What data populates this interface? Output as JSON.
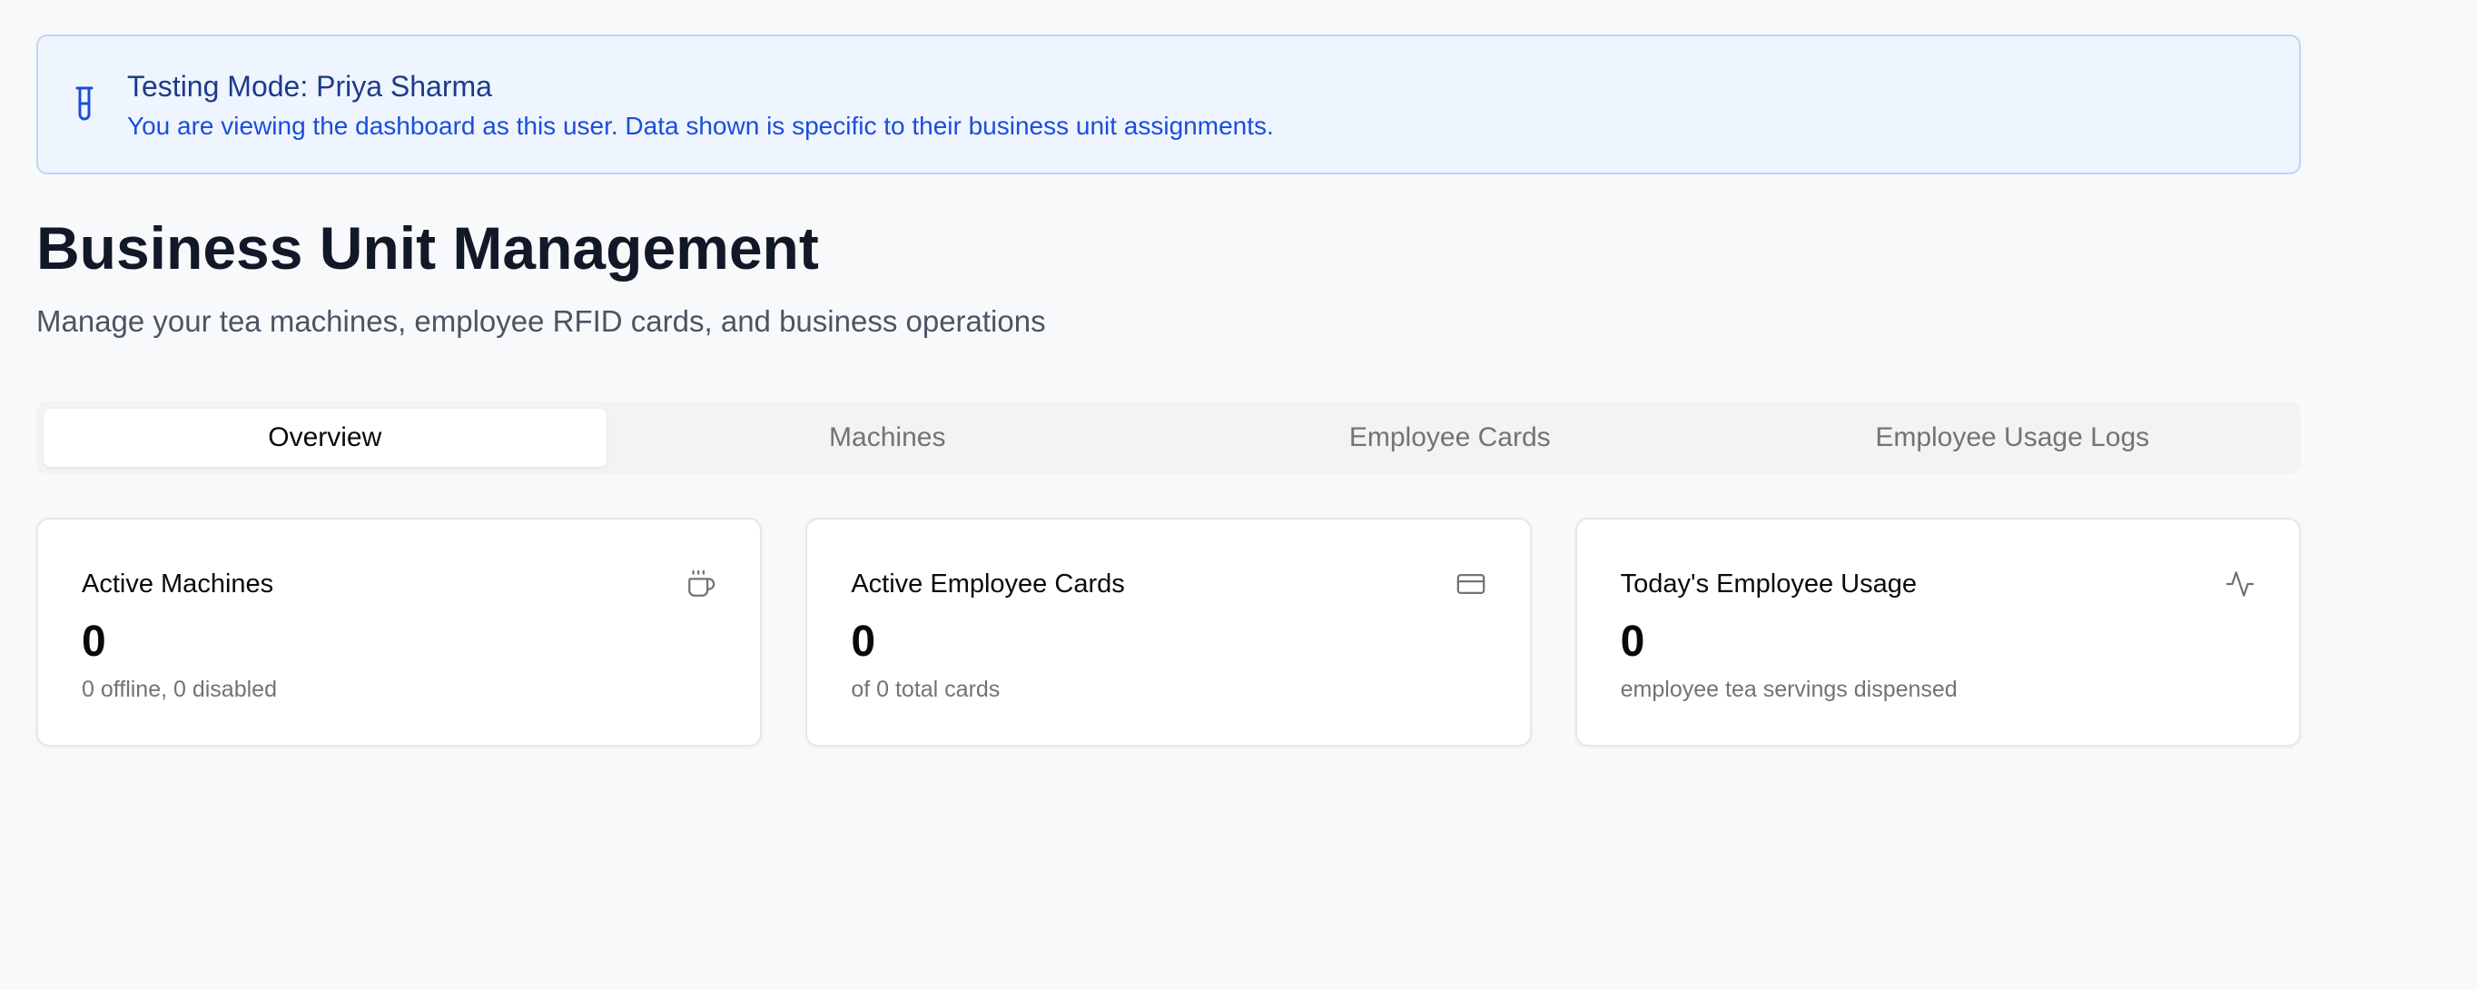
{
  "banner": {
    "icon": "test-tube-icon",
    "title": "Testing Mode: Priya Sharma",
    "description": "You are viewing the dashboard as this user. Data shown is specific to their business unit assignments.",
    "accent_color": "#1d4ed8",
    "background_color": "#eef5fe"
  },
  "header": {
    "title": "Business Unit Management",
    "subtitle": "Manage your tea machines, employee RFID cards, and business operations"
  },
  "tabs": [
    {
      "label": "Overview",
      "active": true
    },
    {
      "label": "Machines",
      "active": false
    },
    {
      "label": "Employee Cards",
      "active": false
    },
    {
      "label": "Employee Usage Logs",
      "active": false
    }
  ],
  "stats": [
    {
      "title": "Active Machines",
      "value": "0",
      "note": "0 offline, 0 disabled",
      "icon": "coffee-cup-icon"
    },
    {
      "title": "Active Employee Cards",
      "value": "0",
      "note": "of 0 total cards",
      "icon": "credit-card-icon"
    },
    {
      "title": "Today's Employee Usage",
      "value": "0",
      "note": "employee tea servings dispensed",
      "icon": "activity-icon"
    }
  ]
}
